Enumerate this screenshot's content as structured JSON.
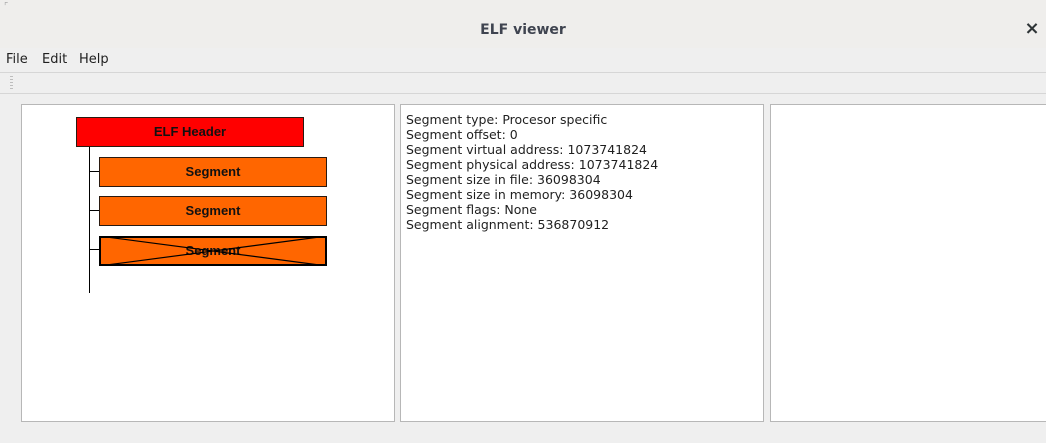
{
  "window": {
    "title": "ELF viewer",
    "close_glyph": "×"
  },
  "menu": {
    "items": [
      "File",
      "Edit",
      "Help"
    ]
  },
  "tree": {
    "header_label": "ELF Header",
    "segments": [
      "Segment",
      "Segment",
      "Segment"
    ],
    "colors": {
      "header": "#ff0000",
      "segment": "#ff6600"
    }
  },
  "details": {
    "lines": [
      "Segment type: Procesor specific",
      "Segment offset: 0",
      "Segment virtual address: 1073741824",
      "Segment physical address: 1073741824",
      "Segment size in file: 36098304",
      "Segment size in memory: 36098304",
      "Segment flags: None",
      "Segment alignment: 536870912"
    ]
  }
}
